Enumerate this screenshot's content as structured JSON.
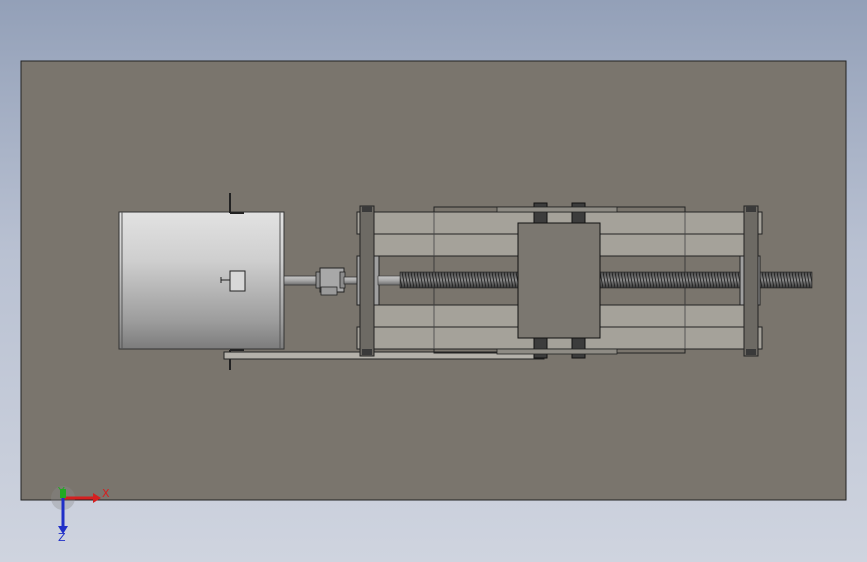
{
  "viewport": {
    "background_gradient": [
      "#93a0b8",
      "#cfd4df"
    ],
    "plate_color": "#7a756d",
    "part_color": "#a09d95"
  },
  "triad": {
    "x_label": "X",
    "y_label": "Y",
    "z_label": "Z",
    "x_color": "#d42020",
    "y_color": "#22aa22",
    "z_color": "#2030c8"
  }
}
